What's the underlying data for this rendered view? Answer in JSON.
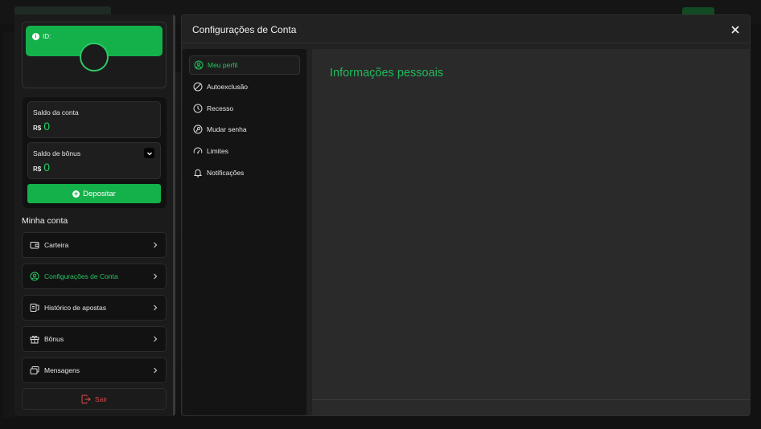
{
  "sidebar": {
    "profile": {
      "id_label": "ID:"
    },
    "balances": {
      "account": {
        "label": "Saldo da conta",
        "currency": "R$",
        "value": "0"
      },
      "bonus": {
        "label": "Saldo de bônus",
        "currency": "R$",
        "value": "0"
      }
    },
    "deposit_label": "Depositar",
    "section_title": "Minha conta",
    "menu": [
      {
        "label": "Carteira",
        "icon": "wallet-icon"
      },
      {
        "label": "Configurações de Conta",
        "icon": "user-circle-icon"
      },
      {
        "label": "Histórico de apostas",
        "icon": "ticket-icon"
      },
      {
        "label": "Bônus",
        "icon": "gift-icon"
      },
      {
        "label": "Mensagens",
        "icon": "messages-icon"
      }
    ],
    "logout_label": "Sair"
  },
  "modal": {
    "title": "Configurações de Conta",
    "nav": [
      {
        "label": "Meu perfil",
        "icon": "user-circle-icon"
      },
      {
        "label": "Autoexclusão",
        "icon": "block-icon"
      },
      {
        "label": "Recesso",
        "icon": "clock-icon"
      },
      {
        "label": "Mudar senha",
        "icon": "key-icon"
      },
      {
        "label": "Limites",
        "icon": "gauge-icon"
      },
      {
        "label": "Notificações",
        "icon": "bell-icon"
      }
    ],
    "content_title": "Informações pessoais"
  },
  "colors": {
    "accent": "#14b04a",
    "accent_text": "#24c862",
    "danger": "#e04848",
    "panel": "#1b1b1b"
  }
}
